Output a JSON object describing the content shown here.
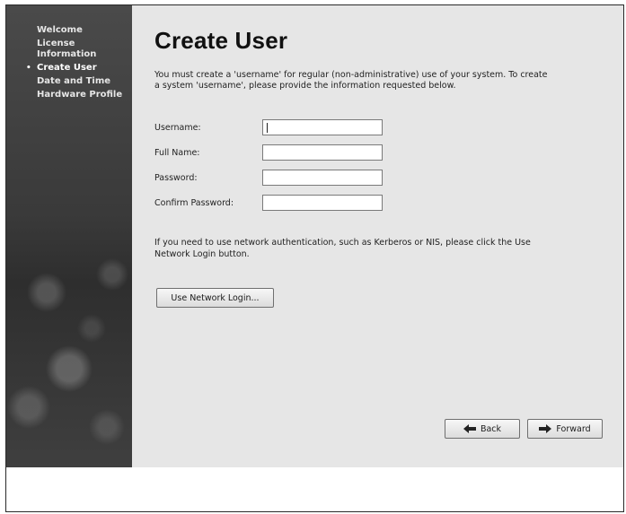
{
  "sidebar": {
    "steps": [
      {
        "label": "Welcome",
        "active": false
      },
      {
        "label": "License Information",
        "active": false
      },
      {
        "label": "Create User",
        "active": true
      },
      {
        "label": "Date and Time",
        "active": false
      },
      {
        "label": "Hardware Profile",
        "active": false
      }
    ],
    "active_marker": "•"
  },
  "main": {
    "title": "Create User",
    "intro": "You must create a 'username' for regular (non-administrative) use of your system.  To create a system 'username', please provide the information requested below.",
    "fields": [
      {
        "label": "Username:",
        "value": "",
        "focused": true
      },
      {
        "label": "Full Name:",
        "value": "",
        "focused": false
      },
      {
        "label": "Password:",
        "value": "",
        "focused": false
      },
      {
        "label": "Confirm Password:",
        "value": "",
        "focused": false
      }
    ],
    "network_info": "If you need to use network authentication, such as Kerberos or NIS, please click the Use Network Login button.",
    "network_login_button": "Use Network Login...",
    "back_button": "Back",
    "forward_button": "Forward"
  },
  "colors": {
    "sidebar_bg": "#3a3a3a",
    "main_bg": "#e6e6e6",
    "field_border": "#7a7a7a"
  }
}
